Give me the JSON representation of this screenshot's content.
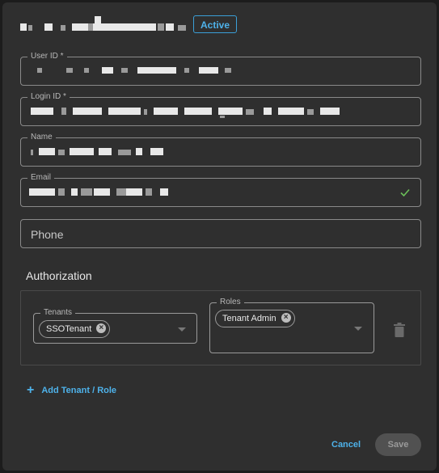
{
  "header": {
    "status_badge": "Active"
  },
  "form": {
    "user_id": {
      "label": "User ID *",
      "value": ""
    },
    "login_id": {
      "label": "Login ID *",
      "value": ""
    },
    "name": {
      "label": "Name",
      "value": ""
    },
    "email": {
      "label": "Email",
      "value": ""
    },
    "phone": {
      "placeholder": "Phone",
      "value": ""
    }
  },
  "authorization": {
    "title": "Authorization",
    "tenants": {
      "label": "Tenants",
      "chips": [
        "SSOTenant"
      ]
    },
    "roles": {
      "label": "Roles",
      "chips": [
        "Tenant Admin"
      ]
    },
    "add_label": "Add Tenant / Role"
  },
  "actions": {
    "cancel_label": "Cancel",
    "save_label": "Save"
  },
  "colors": {
    "accent": "#4eb2ea",
    "background": "#2f2f2f",
    "check": "#6bbf59"
  },
  "icons": {
    "email_valid": "check-icon",
    "delete_row": "trash-icon",
    "add": "plus-icon",
    "chip_remove": "close-circle-icon",
    "dropdown": "chevron-down-icon"
  }
}
